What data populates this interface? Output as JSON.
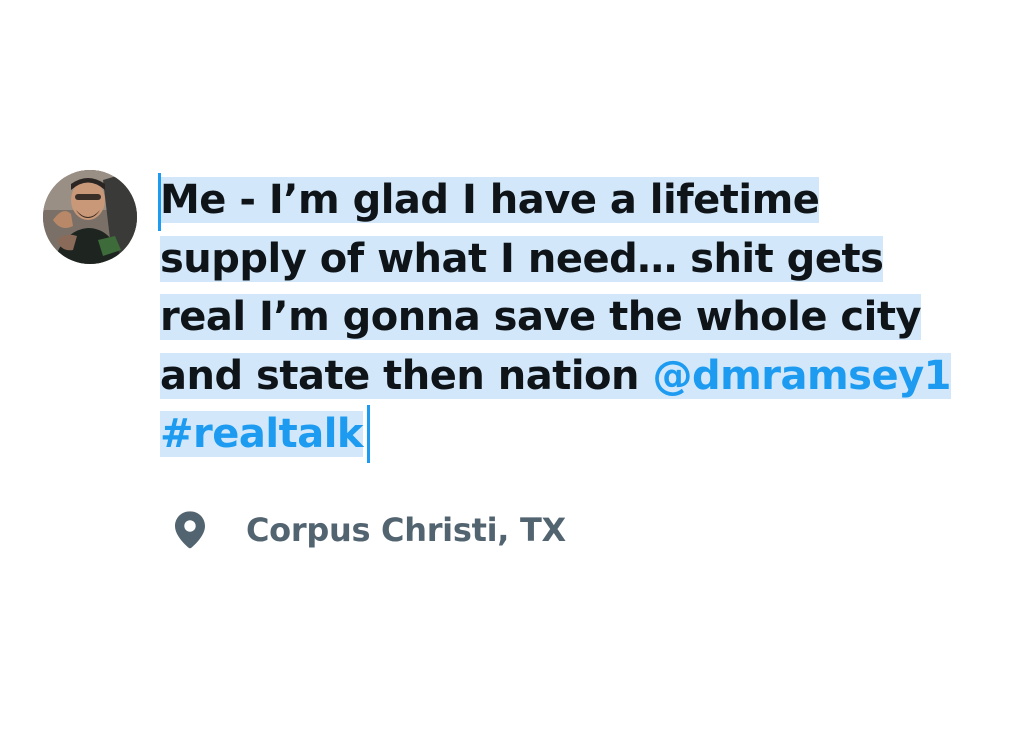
{
  "tweet": {
    "lines": [
      "Me -   I’m glad I have a lifetime",
      "supply of what I need… shit gets",
      "real I’m gonna save the whole city",
      "and state then nation "
    ],
    "mention": "@dmramsey1",
    "hashtag": "#realtalk"
  },
  "location": {
    "icon": "map-pin-icon",
    "label": "Corpus Christi, TX"
  },
  "colors": {
    "text": "#0f1419",
    "link": "#1d9bf0",
    "selection": "#d2e8fa",
    "secondary": "#536471"
  }
}
